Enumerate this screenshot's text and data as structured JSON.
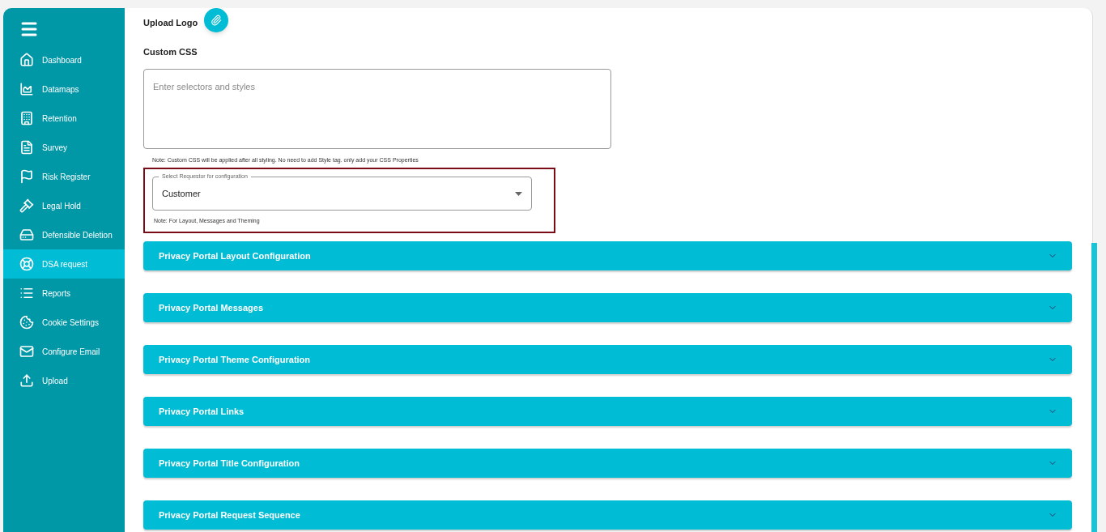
{
  "sidebar": {
    "items": [
      {
        "label": "Dashboard",
        "selected": false
      },
      {
        "label": "Datamaps",
        "selected": false
      },
      {
        "label": "Retention",
        "selected": false
      },
      {
        "label": "Survey",
        "selected": false
      },
      {
        "label": "Risk Register",
        "selected": false
      },
      {
        "label": "Legal Hold",
        "selected": false
      },
      {
        "label": "Defensible Deletion",
        "selected": false
      },
      {
        "label": "DSA request",
        "selected": true
      },
      {
        "label": "Reports",
        "selected": false
      },
      {
        "label": "Cookie Settings",
        "selected": false
      },
      {
        "label": "Configure Email",
        "selected": false
      },
      {
        "label": "Upload",
        "selected": false
      }
    ]
  },
  "upload_logo": {
    "label": "Upload Logo"
  },
  "custom_css": {
    "label": "Custom CSS",
    "placeholder": "Enter selectors and styles",
    "note": "Note: Custom CSS will be applied after all styling. No need to add Style tag. only add your CSS Properties"
  },
  "requestor_select": {
    "label": "Select Requestor for configuration",
    "value": "Customer",
    "note": "Note: For Layout, Messages and Theming"
  },
  "sections": [
    {
      "title": "Privacy Portal Layout Configuration",
      "expanded": false
    },
    {
      "title": "Privacy Portal Messages",
      "expanded": false
    },
    {
      "title": "Privacy Portal Theme Configuration",
      "expanded": false
    },
    {
      "title": "Privacy Portal Links",
      "expanded": false
    },
    {
      "title": "Privacy Portal Title Configuration",
      "expanded": false
    },
    {
      "title": "Privacy Portal Request Sequence",
      "expanded": false
    }
  ]
}
